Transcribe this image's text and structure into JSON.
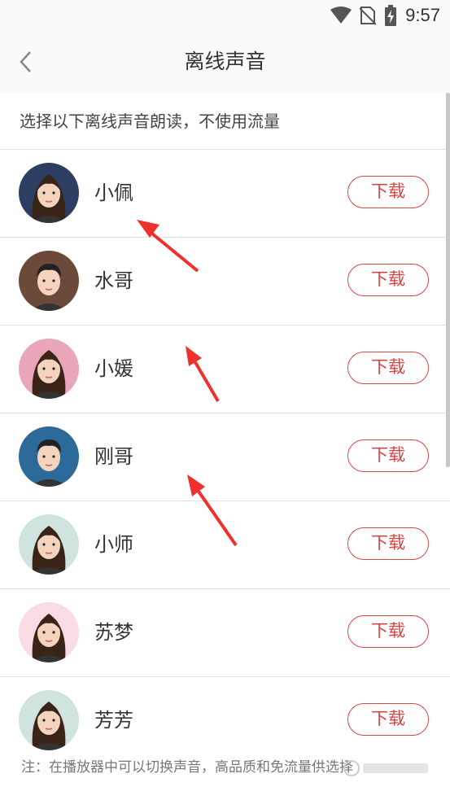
{
  "status": {
    "time": "9:57"
  },
  "header": {
    "title": "离线声音"
  },
  "intro": "选择以下离线声音朗读，不使用流量",
  "download_label": "下载",
  "voices": [
    {
      "name": "小佩",
      "avatar": "female-avatar",
      "bg": "#2c3f63"
    },
    {
      "name": "水哥",
      "avatar": "male-avatar",
      "bg": "#6b4a3a"
    },
    {
      "name": "小媛",
      "avatar": "female-avatar",
      "bg": "#e9a6b8"
    },
    {
      "name": "刚哥",
      "avatar": "male-avatar",
      "bg": "#2c6a9a"
    },
    {
      "name": "小师",
      "avatar": "female-avatar",
      "bg": "#cfe3df"
    },
    {
      "name": "苏梦",
      "avatar": "female-avatar",
      "bg": "#f9dbe4"
    },
    {
      "name": "芳芳",
      "avatar": "female-avatar",
      "bg": "#cfe3df"
    }
  ],
  "note": "注：在播放器中可以切换声音，高品质和免流量供选择",
  "colors": {
    "accent": "#d64545",
    "arrow": "#f0302a"
  }
}
